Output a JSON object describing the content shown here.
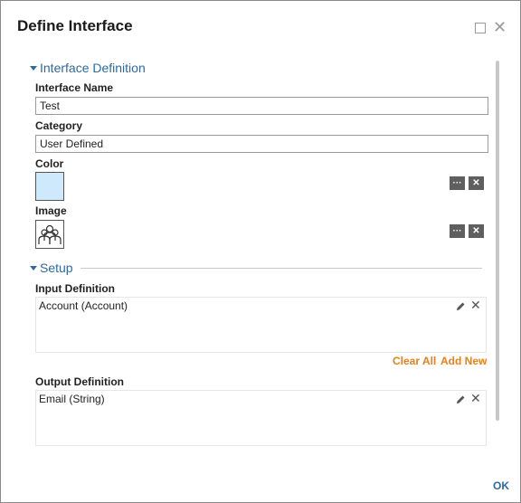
{
  "dialog": {
    "title": "Define Interface",
    "close_glyph": "✕",
    "ok_label": "OK"
  },
  "interface_definition": {
    "section_label": "Interface Definition",
    "name_label": "Interface Name",
    "name_value": "Test",
    "category_label": "Category",
    "category_value": "User Defined",
    "color_label": "Color",
    "color_value": "#cde9fb",
    "image_label": "Image",
    "more_glyph": "···",
    "clear_glyph": "✕"
  },
  "setup": {
    "section_label": "Setup",
    "input_label": "Input Definition",
    "inputs": [
      "Account (Account)"
    ],
    "clear_all_label": "Clear All",
    "add_new_label": "Add New",
    "output_label": "Output Definition",
    "outputs": [
      "Email (String)"
    ],
    "delete_glyph": "✕"
  },
  "icons": [
    "maximize-icon",
    "close-icon",
    "pencil-icon",
    "people-image-icon"
  ],
  "colors": {
    "accent": "#2d6aa3",
    "link": "#e8801a",
    "button": "#5f5f5f"
  }
}
